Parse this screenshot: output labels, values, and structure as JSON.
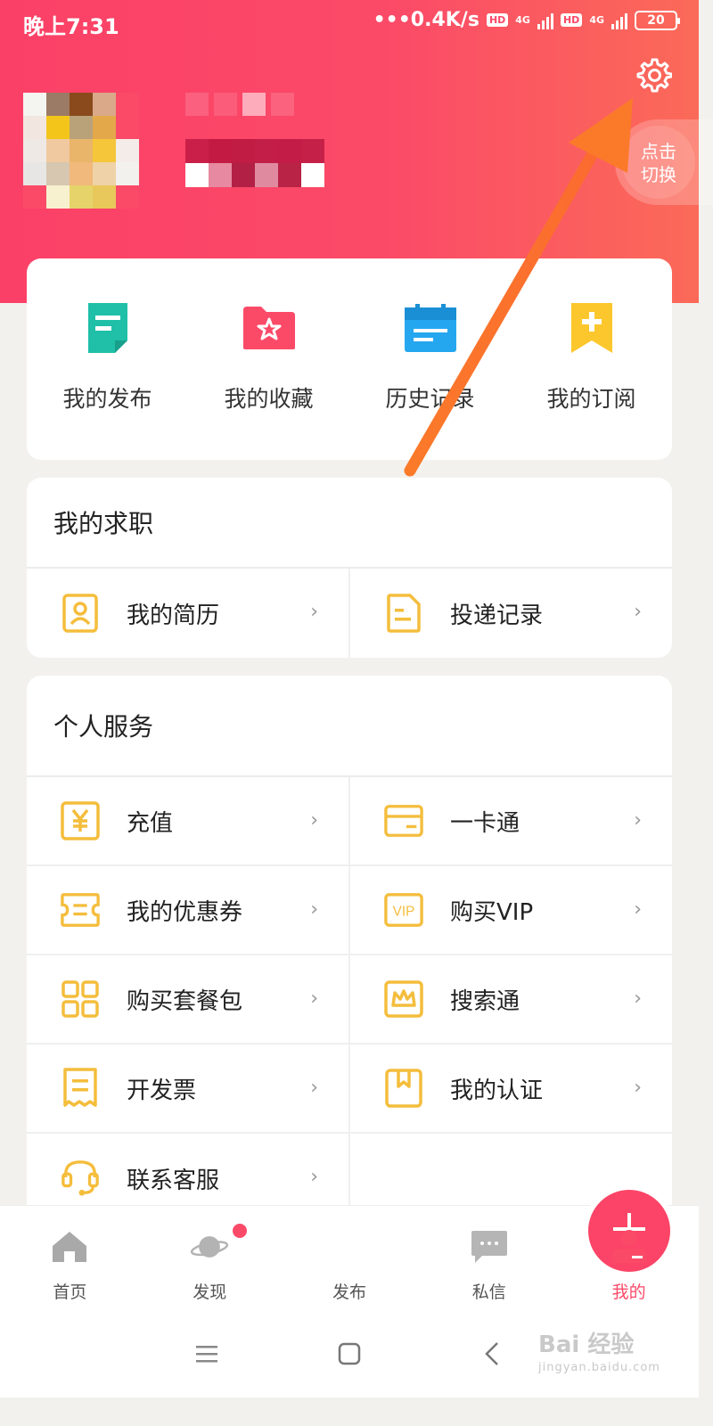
{
  "status_bar": {
    "time": "晚上7:31",
    "speed": "•••0.4K/s",
    "hd": "HD",
    "network": "4G",
    "battery": "20"
  },
  "header": {
    "switch_label": "点击\n切换",
    "switch_line1": "点击",
    "switch_line2": "切换"
  },
  "quick_actions": [
    {
      "label": "我的发布",
      "icon": "document-icon",
      "color": "#1fbfa8"
    },
    {
      "label": "我的收藏",
      "icon": "star-folder-icon",
      "color": "#fb4a68"
    },
    {
      "label": "历史记录",
      "icon": "calendar-icon",
      "color": "#25a7f0"
    },
    {
      "label": "我的订阅",
      "icon": "bookmark-plus-icon",
      "color": "#fbc72c"
    }
  ],
  "job_section": {
    "title": "我的求职",
    "items": [
      {
        "label": "我的简历",
        "icon": "resume-icon"
      },
      {
        "label": "投递记录",
        "icon": "delivery-record-icon"
      }
    ]
  },
  "service_section": {
    "title": "个人服务",
    "items": [
      {
        "label": "充值",
        "icon": "yen-icon"
      },
      {
        "label": "一卡通",
        "icon": "card-icon"
      },
      {
        "label": "我的优惠券",
        "icon": "coupon-icon"
      },
      {
        "label": "购买VIP",
        "icon": "vip-icon"
      },
      {
        "label": "购买套餐包",
        "icon": "package-grid-icon"
      },
      {
        "label": "搜索通",
        "icon": "crown-icon"
      },
      {
        "label": "开发票",
        "icon": "invoice-icon"
      },
      {
        "label": "我的认证",
        "icon": "certification-icon"
      },
      {
        "label": "联系客服",
        "icon": "customer-service-icon"
      }
    ]
  },
  "arrow_glyph": "›",
  "tabbar": [
    {
      "label": "首页",
      "icon": "home-icon"
    },
    {
      "label": "发现",
      "icon": "planet-icon"
    },
    {
      "label": "发布",
      "icon": "plus-icon"
    },
    {
      "label": "私信",
      "icon": "message-icon"
    },
    {
      "label": "我的",
      "icon": "profile-icon"
    }
  ],
  "watermark": {
    "brand": "Bai 经验",
    "url": "jingyan.baidu.com"
  },
  "colors": {
    "brand": "#fb4a68",
    "icon_yellow": "#f4bd3c"
  }
}
